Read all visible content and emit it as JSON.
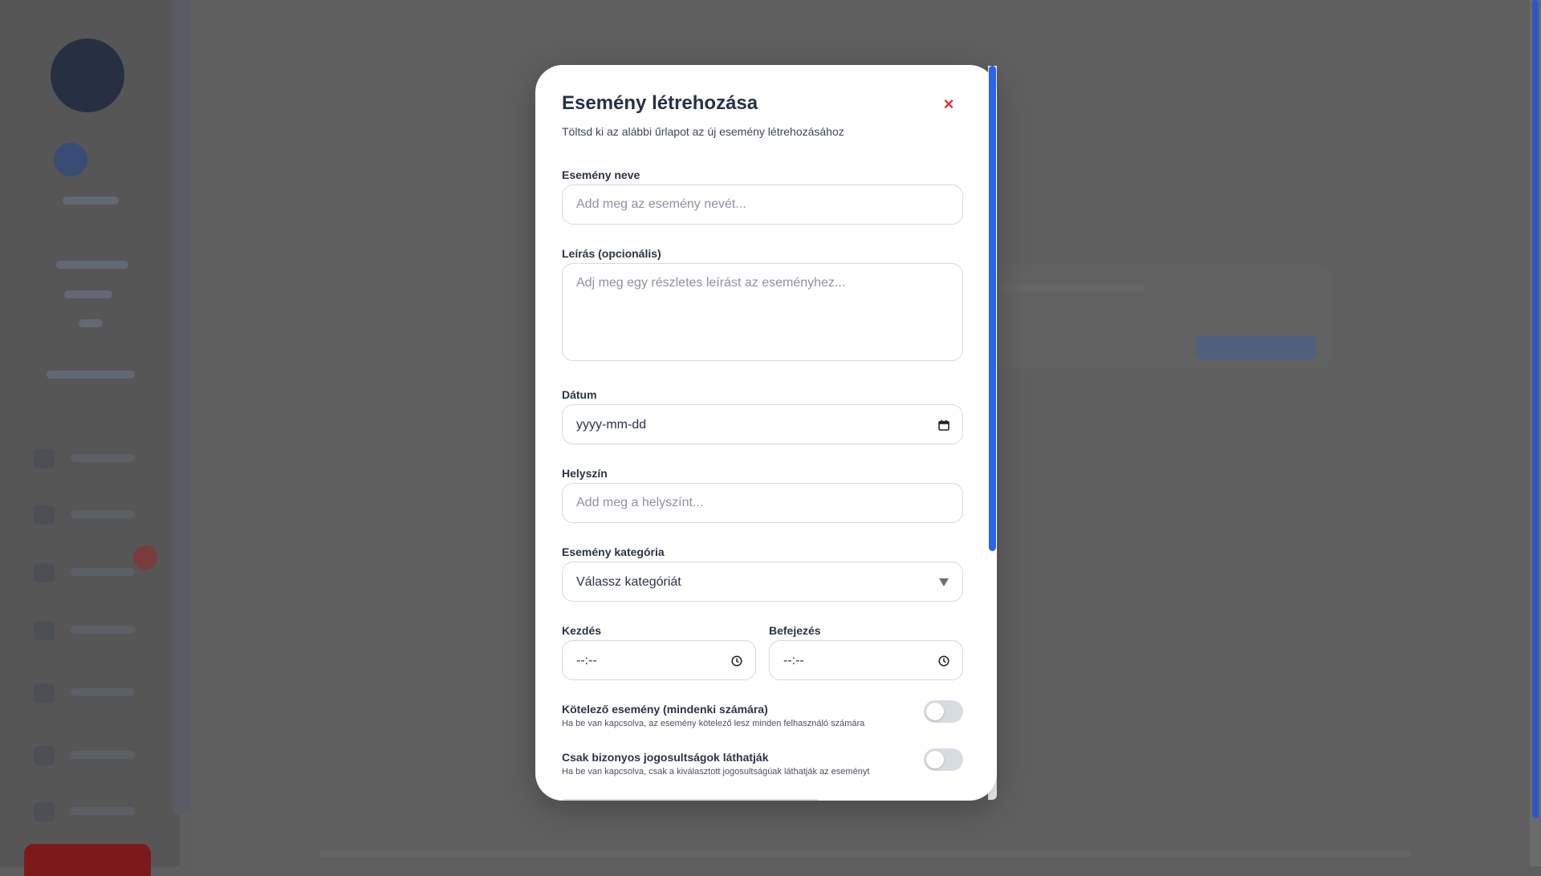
{
  "modal": {
    "title": "Esemény létrehozása",
    "subtitle": "Töltsd ki az alábbi űrlapot az új esemény létrehozásához",
    "close_glyph": "×"
  },
  "fields": {
    "name": {
      "label": "Esemény neve",
      "placeholder": "Add meg az esemény nevét..."
    },
    "description": {
      "label": "Leírás (opcionális)",
      "placeholder": "Adj meg egy részletes leírást az eseményhez..."
    },
    "date": {
      "label": "Dátum",
      "value": "yyyy-mm-dd"
    },
    "location": {
      "label": "Helyszín",
      "placeholder": "Add meg a helyszínt..."
    },
    "category": {
      "label": "Esemény kategória",
      "value": "Válassz kategóriát"
    },
    "start": {
      "label": "Kezdés",
      "value": "--:--"
    },
    "end": {
      "label": "Befejezés",
      "value": "--:--"
    }
  },
  "toggles": [
    {
      "title": "Kötelező esemény (mindenki számára)",
      "description": "Ha be van kapcsolva, az esemény kötelező lesz minden felhasználó számára",
      "on": false
    },
    {
      "title": "Csak bizonyos jogosultságok láthatják",
      "description": "Ha be van kapcsolva, csak a kiválasztott jogosultságúak láthatják az eseményt",
      "on": false
    }
  ],
  "colors": {
    "accent": "#2a64e8",
    "close": "#e0323a",
    "overlay": "#5e5e5e"
  },
  "icons": [
    "close-icon",
    "calendar-icon",
    "clock-icon",
    "chevron-down-icon"
  ]
}
